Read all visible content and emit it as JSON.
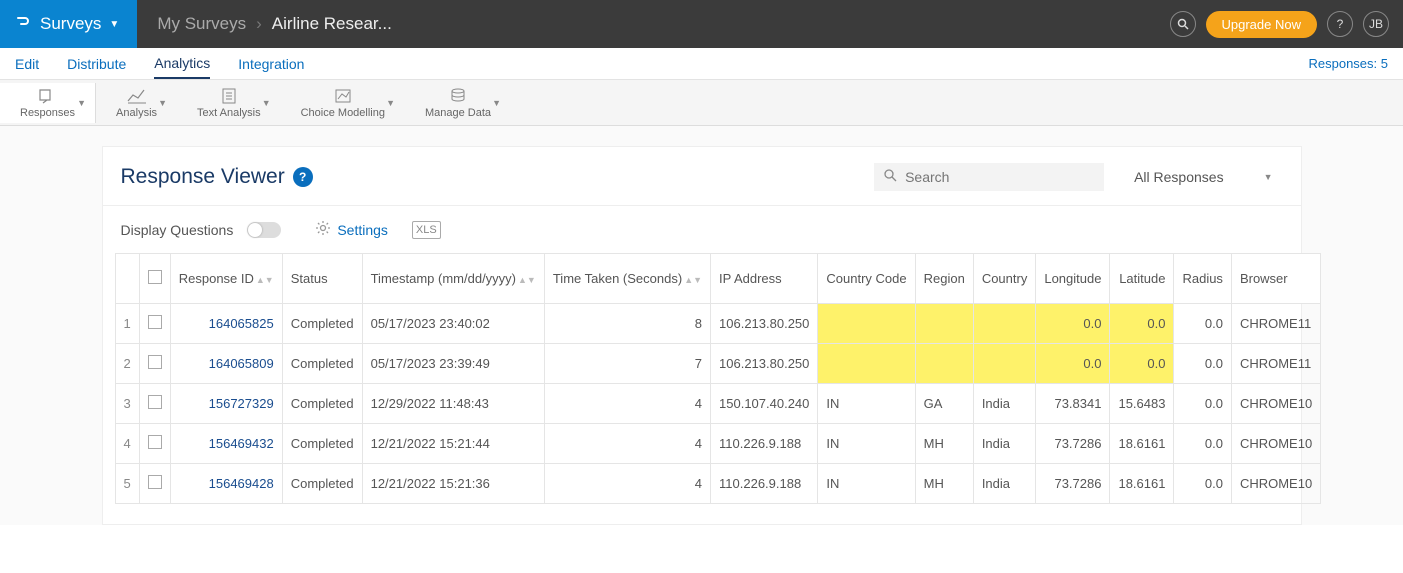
{
  "topbar": {
    "surveys_label": "Surveys",
    "breadcrumb_parent": "My Surveys",
    "breadcrumb_current": "Airline Resear...",
    "upgrade_label": "Upgrade Now",
    "user_initials": "JB"
  },
  "tabs": {
    "edit": "Edit",
    "distribute": "Distribute",
    "analytics": "Analytics",
    "integration": "Integration",
    "responses_count": "Responses: 5"
  },
  "toolbar": {
    "responses": "Responses",
    "analysis": "Analysis",
    "text_analysis": "Text Analysis",
    "choice_modelling": "Choice Modelling",
    "manage_data": "Manage Data"
  },
  "panel": {
    "title": "Response Viewer",
    "search_placeholder": "Search",
    "filter_label": "All Responses"
  },
  "controls": {
    "display_questions": "Display Questions",
    "settings": "Settings",
    "xls": "XLS"
  },
  "columns": {
    "response_id": "Response ID",
    "status": "Status",
    "timestamp": "Timestamp (mm/dd/yyyy)",
    "time_taken": "Time Taken (Seconds)",
    "ip": "IP Address",
    "country_code": "Country Code",
    "region": "Region",
    "country": "Country",
    "longitude": "Longitude",
    "latitude": "Latitude",
    "radius": "Radius",
    "browser": "Browser"
  },
  "rows": [
    {
      "idx": "1",
      "id": "164065825",
      "status": "Completed",
      "ts": "05/17/2023 23:40:02",
      "tt": "8",
      "ip": "106.213.80.250",
      "cc": "",
      "region": "",
      "country": "",
      "lon": "0.0",
      "lat": "0.0",
      "radius": "0.0",
      "browser": "CHROME11",
      "hl": true
    },
    {
      "idx": "2",
      "id": "164065809",
      "status": "Completed",
      "ts": "05/17/2023 23:39:49",
      "tt": "7",
      "ip": "106.213.80.250",
      "cc": "",
      "region": "",
      "country": "",
      "lon": "0.0",
      "lat": "0.0",
      "radius": "0.0",
      "browser": "CHROME11",
      "hl": true
    },
    {
      "idx": "3",
      "id": "156727329",
      "status": "Completed",
      "ts": "12/29/2022 11:48:43",
      "tt": "4",
      "ip": "150.107.40.240",
      "cc": "IN",
      "region": "GA",
      "country": "India",
      "lon": "73.8341",
      "lat": "15.6483",
      "radius": "0.0",
      "browser": "CHROME10",
      "hl": false
    },
    {
      "idx": "4",
      "id": "156469432",
      "status": "Completed",
      "ts": "12/21/2022 15:21:44",
      "tt": "4",
      "ip": "110.226.9.188",
      "cc": "IN",
      "region": "MH",
      "country": "India",
      "lon": "73.7286",
      "lat": "18.6161",
      "radius": "0.0",
      "browser": "CHROME10",
      "hl": false
    },
    {
      "idx": "5",
      "id": "156469428",
      "status": "Completed",
      "ts": "12/21/2022 15:21:36",
      "tt": "4",
      "ip": "110.226.9.188",
      "cc": "IN",
      "region": "MH",
      "country": "India",
      "lon": "73.7286",
      "lat": "18.6161",
      "radius": "0.0",
      "browser": "CHROME10",
      "hl": false
    }
  ]
}
